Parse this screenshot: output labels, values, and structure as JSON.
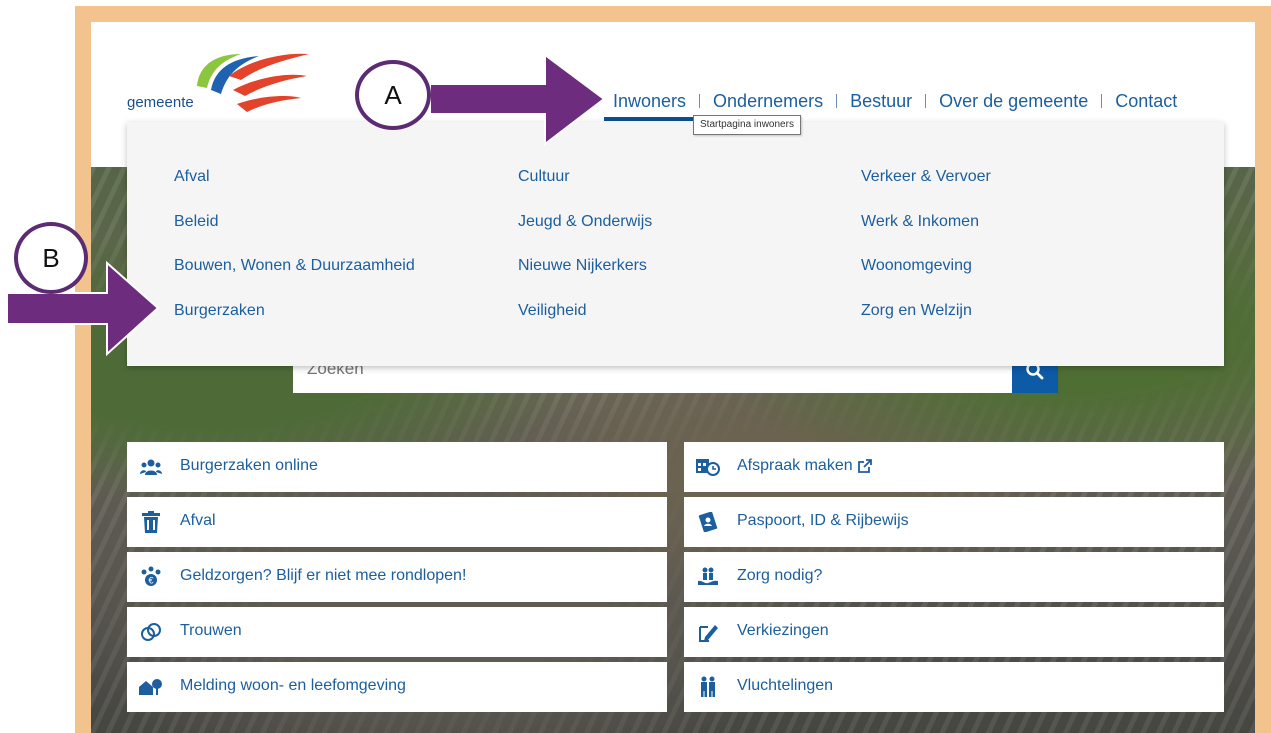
{
  "header": {
    "logo_text": "gemeente"
  },
  "nav": {
    "items": [
      "Inwoners",
      "Ondernemers",
      "Bestuur",
      "Over de gemeente",
      "Contact"
    ],
    "tooltip": "Startpagina inwoners"
  },
  "dropdown": {
    "columns": [
      [
        "Afval",
        "Beleid",
        "Bouwen, Wonen & Duurzaamheid",
        "Burgerzaken"
      ],
      [
        "Cultuur",
        "Jeugd & Onderwijs",
        "Nieuwe Nijkerkers",
        "Veiligheid"
      ],
      [
        "Verkeer & Vervoer",
        "Werk & Inkomen",
        "Woonomgeving",
        "Zorg en Welzijn"
      ]
    ]
  },
  "search": {
    "placeholder": "Zoeken"
  },
  "quick_links": {
    "left": [
      {
        "label": "Burgerzaken online",
        "icon": "people-group-icon"
      },
      {
        "label": "Afval",
        "icon": "trash-icon"
      },
      {
        "label": "Geldzorgen? Blijf er niet mee rondlopen!",
        "icon": "money-help-icon"
      },
      {
        "label": "Trouwen",
        "icon": "rings-icon"
      },
      {
        "label": "Melding woon- en leefomgeving",
        "icon": "house-tree-icon"
      }
    ],
    "right": [
      {
        "label": "Afspraak maken",
        "icon": "calendar-clock-icon"
      },
      {
        "label": "Paspoort, ID & Rijbewijs",
        "icon": "passport-icon"
      },
      {
        "label": "Zorg nodig?",
        "icon": "care-hands-icon"
      },
      {
        "label": "Verkiezingen",
        "icon": "vote-pencil-icon"
      },
      {
        "label": "Vluchtelingen",
        "icon": "refugees-icon"
      }
    ]
  },
  "annotations": {
    "a_label": "A",
    "b_label": "B",
    "color": "#5c2b72"
  },
  "colors": {
    "link": "#1c5e9e",
    "frame": "#f3c38d",
    "primary": "#0d5aa7"
  }
}
